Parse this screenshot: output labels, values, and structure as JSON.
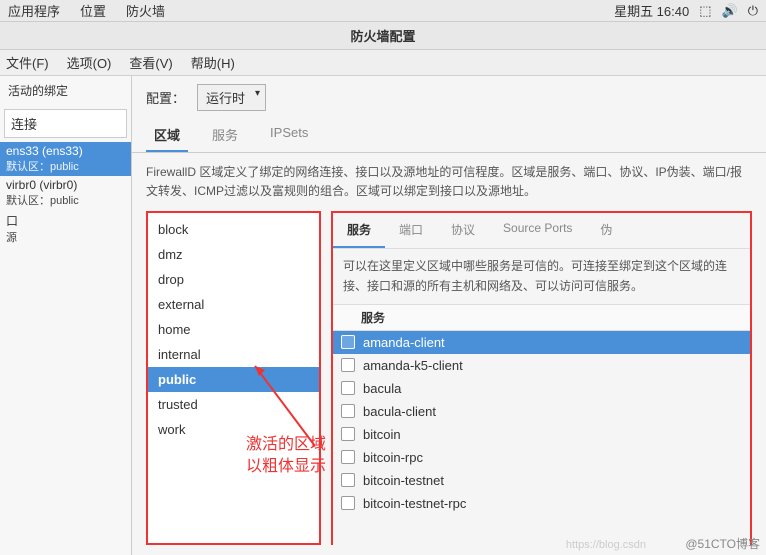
{
  "topbar": {
    "left": [
      "应用程序",
      "位置",
      "防火墙"
    ],
    "clock": "星期五 16:40"
  },
  "window": {
    "title": "防火墙配置"
  },
  "menubar": [
    "文件(F)",
    "选项(O)",
    "查看(V)",
    "帮助(H)"
  ],
  "leftPanel": {
    "header": "活动的绑定",
    "subheader": "连接",
    "ifaces": [
      {
        "name": "ens33 (ens33)",
        "zone": "默认区：public",
        "active": true
      },
      {
        "name": "virbr0 (virbr0)",
        "zone": "默认区：public",
        "active": false
      },
      {
        "name": "口",
        "zone": "源",
        "active": false
      }
    ]
  },
  "config": {
    "label": "配置：",
    "value": "运行时"
  },
  "tabs1": [
    {
      "label": "区域",
      "active": true
    },
    {
      "label": "服务",
      "active": false
    },
    {
      "label": "IPSets",
      "active": false
    }
  ],
  "description": "FirewallD 区域定义了绑定的网络连接、接口以及源地址的可信程度。区域是服务、端口、协议、IP伪装、端口/报文转发、ICMP过滤以及富规则的组合。区域可以绑定到接口以及源地址。",
  "zones": [
    "block",
    "dmz",
    "drop",
    "external",
    "home",
    "internal",
    "public",
    "trusted",
    "work"
  ],
  "zoneSelected": "public",
  "tabs2": [
    {
      "label": "服务",
      "active": true
    },
    {
      "label": "端口",
      "active": false
    },
    {
      "label": "协议",
      "active": false
    },
    {
      "label": "Source Ports",
      "active": false
    },
    {
      "label": "伪",
      "active": false
    }
  ],
  "svcDesc": "可以在这里定义区域中哪些服务是可信的。可连接至绑定到这个区域的连接、接口和源的所有主机和网络及、可以访问可信服务。",
  "svcHeader": "服务",
  "services": [
    {
      "name": "amanda-client",
      "selected": true
    },
    {
      "name": "amanda-k5-client",
      "selected": false
    },
    {
      "name": "bacula",
      "selected": false
    },
    {
      "name": "bacula-client",
      "selected": false
    },
    {
      "name": "bitcoin",
      "selected": false
    },
    {
      "name": "bitcoin-rpc",
      "selected": false
    },
    {
      "name": "bitcoin-testnet",
      "selected": false
    },
    {
      "name": "bitcoin-testnet-rpc",
      "selected": false
    }
  ],
  "annotation": {
    "text1": "激活的区域",
    "text2": "以粗体显示"
  },
  "watermark": "@51CTO博客",
  "wm2": "https://blog.csdn"
}
